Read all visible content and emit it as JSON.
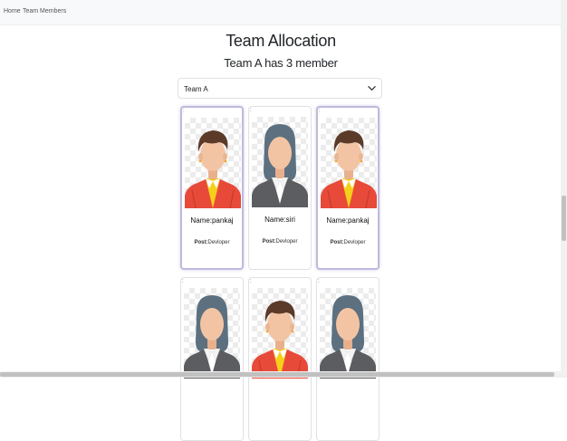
{
  "nav": {
    "home": "Home",
    "team_members": "Team Members"
  },
  "page": {
    "title": "Team Allocation",
    "subtitle": "Team A has 3 member"
  },
  "team_select": {
    "value": "Team A"
  },
  "cards": [
    {
      "marker": ":",
      "name": "Name:pankaj",
      "post_label": "Post:",
      "post_value": "Devloper",
      "avatar": "male-avatar"
    },
    {
      "marker": ":",
      "name": "Name:siri",
      "post_label": "Post:",
      "post_value": "Devloper",
      "avatar": "female-avatar"
    },
    {
      "marker": ":",
      "name": "Name:pankaj",
      "post_label": "Post:",
      "post_value": "Devloper",
      "avatar": "male-avatar"
    },
    {
      "marker": ":",
      "avatar": "female-avatar"
    },
    {
      "marker": ":",
      "avatar": "male-avatar"
    },
    {
      "marker": ":",
      "avatar": "female-avatar"
    }
  ],
  "colors": {
    "selected_border": "#c1b9dc",
    "shirt_red": "#e84a3a",
    "tie_yellow": "#f5cf1a",
    "jacket_gray": "#5b5d60",
    "hair_brown": "#5b3a29",
    "hair_slate": "#5c7080",
    "skin": "#f3c4a3"
  }
}
